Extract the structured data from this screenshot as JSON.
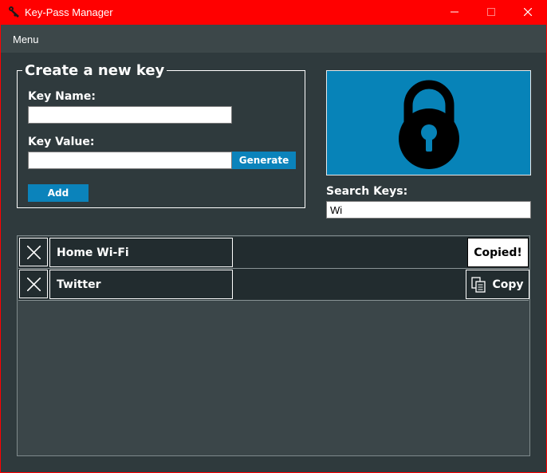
{
  "window": {
    "title": "Key-Pass Manager"
  },
  "menu": {
    "items": [
      {
        "label": "Menu"
      }
    ]
  },
  "create": {
    "legend": "Create a new key",
    "key_name_label": "Key Name:",
    "key_name_value": "",
    "key_value_label": "Key Value:",
    "key_value_value": "",
    "generate_label": "Generate",
    "add_label": "Add"
  },
  "search": {
    "label": "Search Keys:",
    "value": "Wi"
  },
  "keys": [
    {
      "name": "Home Wi-Fi",
      "copy_label": "Copied!"
    },
    {
      "name": "Twitter",
      "copy_label": "Copy"
    }
  ],
  "colors": {
    "accent": "#0b83bb",
    "titlebar": "#ff0000",
    "background": "#2f3a3d"
  },
  "icons": [
    "app-icon",
    "minimize-icon",
    "maximize-icon",
    "close-icon",
    "padlock-icon",
    "delete-x-icon",
    "copy-icon"
  ]
}
